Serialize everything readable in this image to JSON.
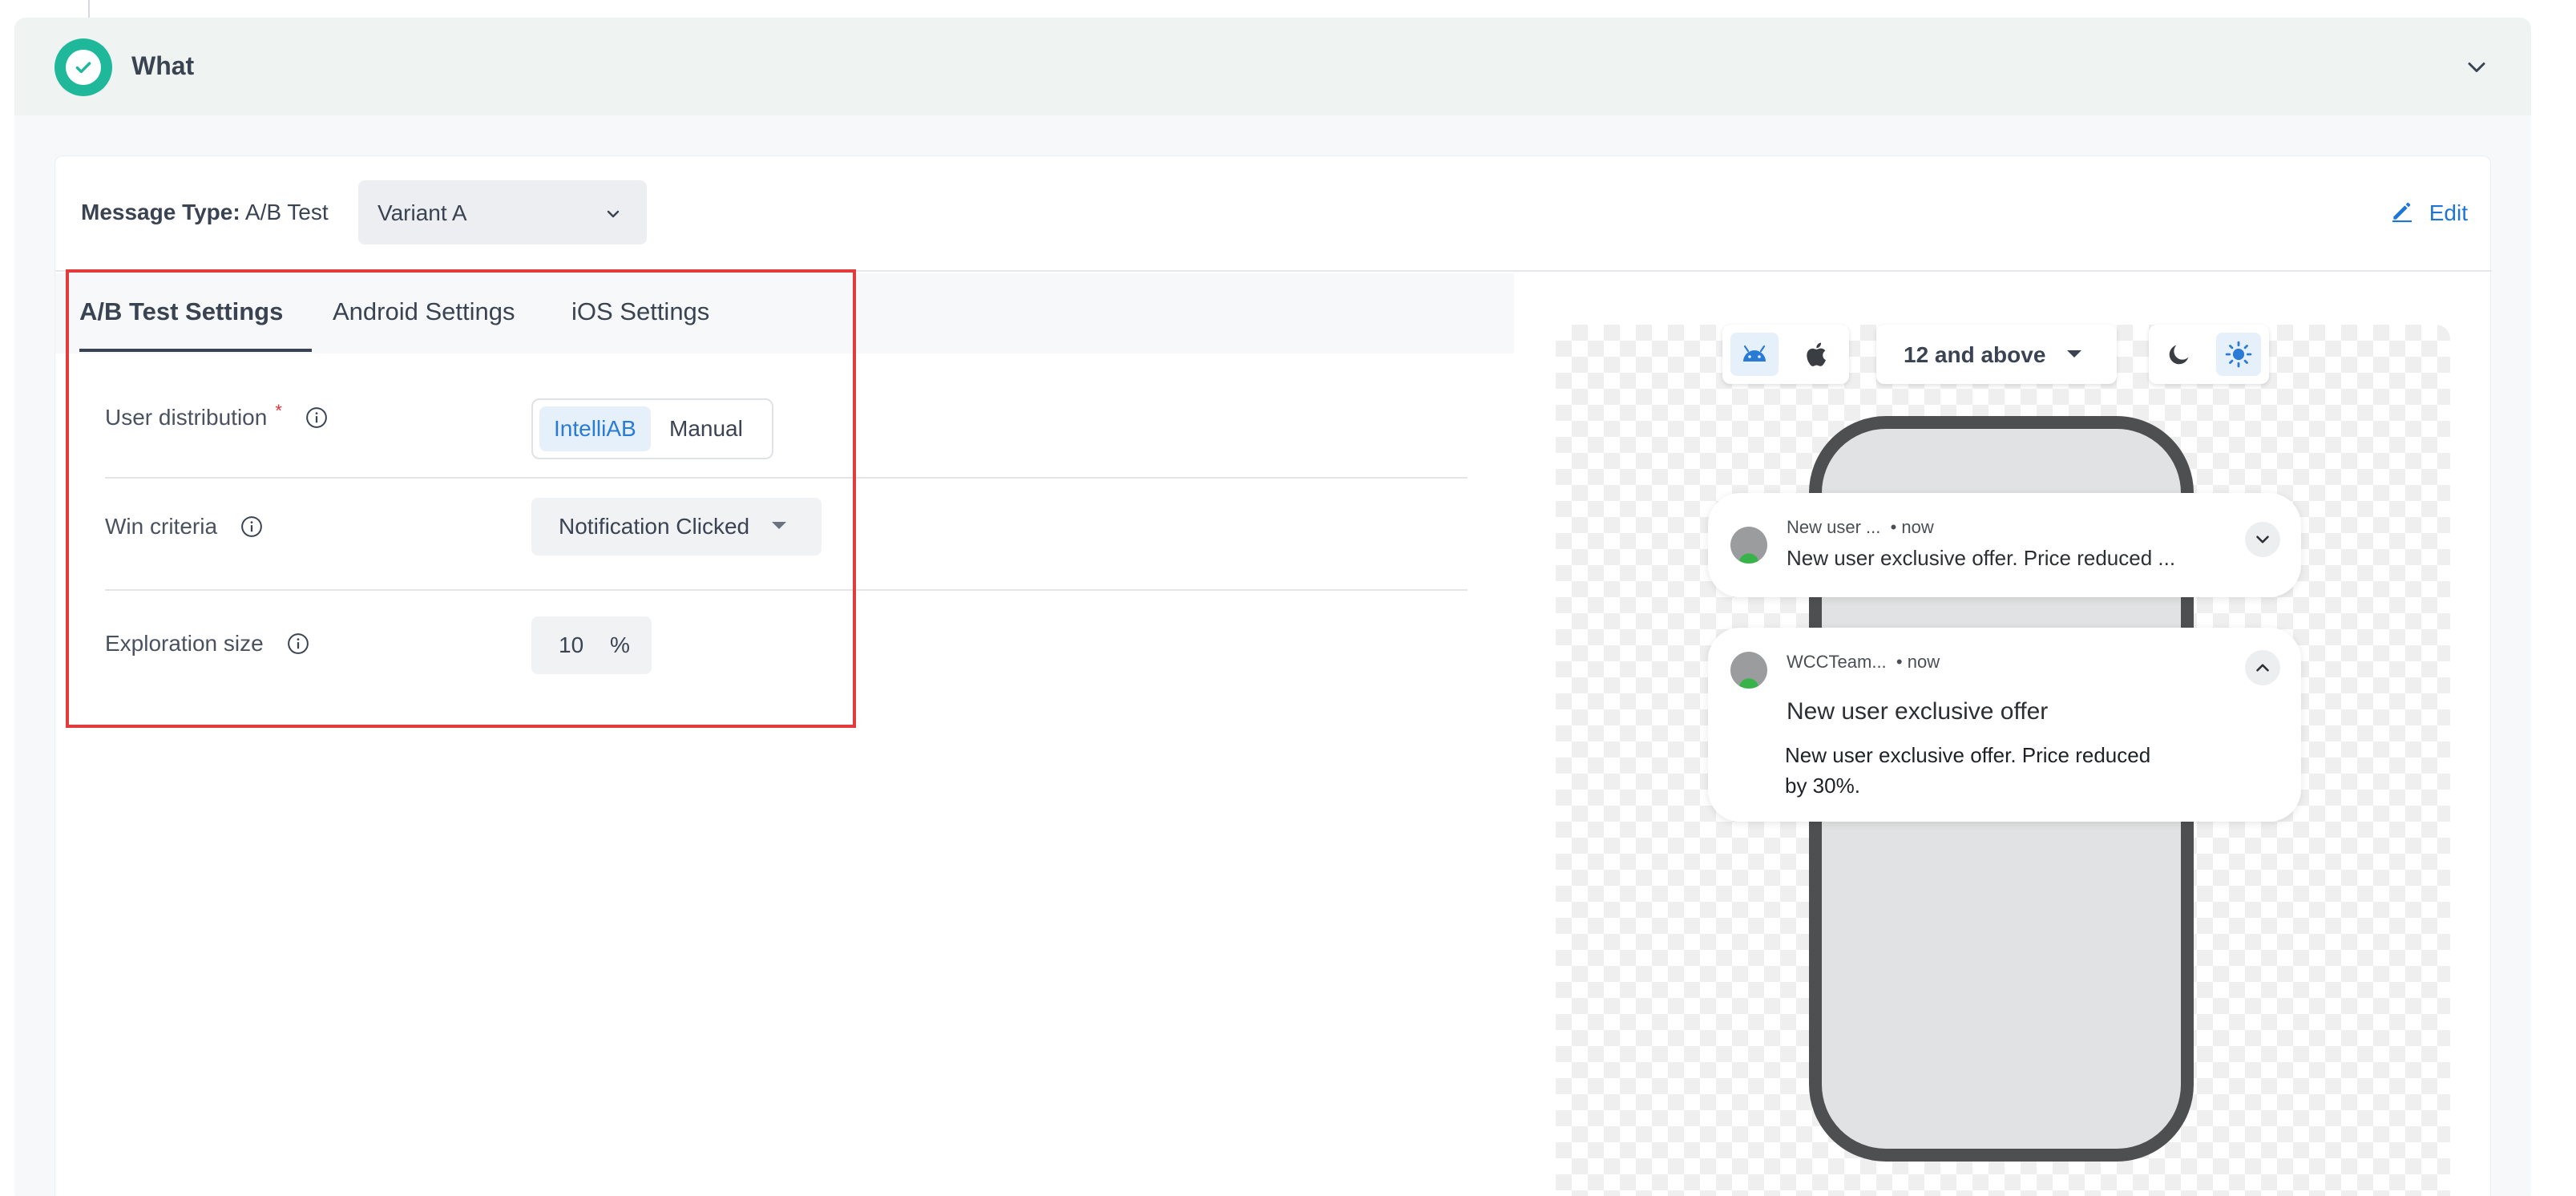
{
  "section": {
    "title": "What"
  },
  "message": {
    "type_label": "Message Type:",
    "type_value": "A/B Test",
    "variant_selected": "Variant A",
    "edit_label": "Edit"
  },
  "tabs": [
    {
      "label": "A/B Test Settings",
      "active": true
    },
    {
      "label": "Android Settings",
      "active": false
    },
    {
      "label": "iOS Settings",
      "active": false
    }
  ],
  "settings": {
    "user_distribution": {
      "label": "User distribution",
      "required_mark": "*",
      "options": [
        "IntelliAB",
        "Manual"
      ],
      "selected": "IntelliAB"
    },
    "win_criteria": {
      "label": "Win criteria",
      "value": "Notification Clicked"
    },
    "exploration_size": {
      "label": "Exploration size",
      "value": "10",
      "unit": "%"
    }
  },
  "preview": {
    "os_selected": "android",
    "os_version": "12 and above",
    "theme_selected": "light",
    "notifications": [
      {
        "app": "New user ...",
        "time": "• now",
        "body": "New user exclusive offer. Price reduced ...",
        "expanded": false
      },
      {
        "app": "WCCTeam...",
        "time": "• now",
        "title": "New user exclusive offer",
        "body": "New user exclusive offer. Price reduced by 30%.",
        "expanded": true
      }
    ]
  },
  "colors": {
    "accent": "#1d75d8",
    "success": "#1fb89a",
    "highlight_box": "#e23b3b",
    "required": "#e0343b"
  },
  "icons": {
    "section_status": "check-circle-icon",
    "collapse": "chevron-down-icon",
    "edit": "pencil-icon",
    "info": "info-icon",
    "android": "android-icon",
    "apple": "apple-icon",
    "dark_mode": "moon-icon",
    "light_mode": "sun-icon"
  }
}
